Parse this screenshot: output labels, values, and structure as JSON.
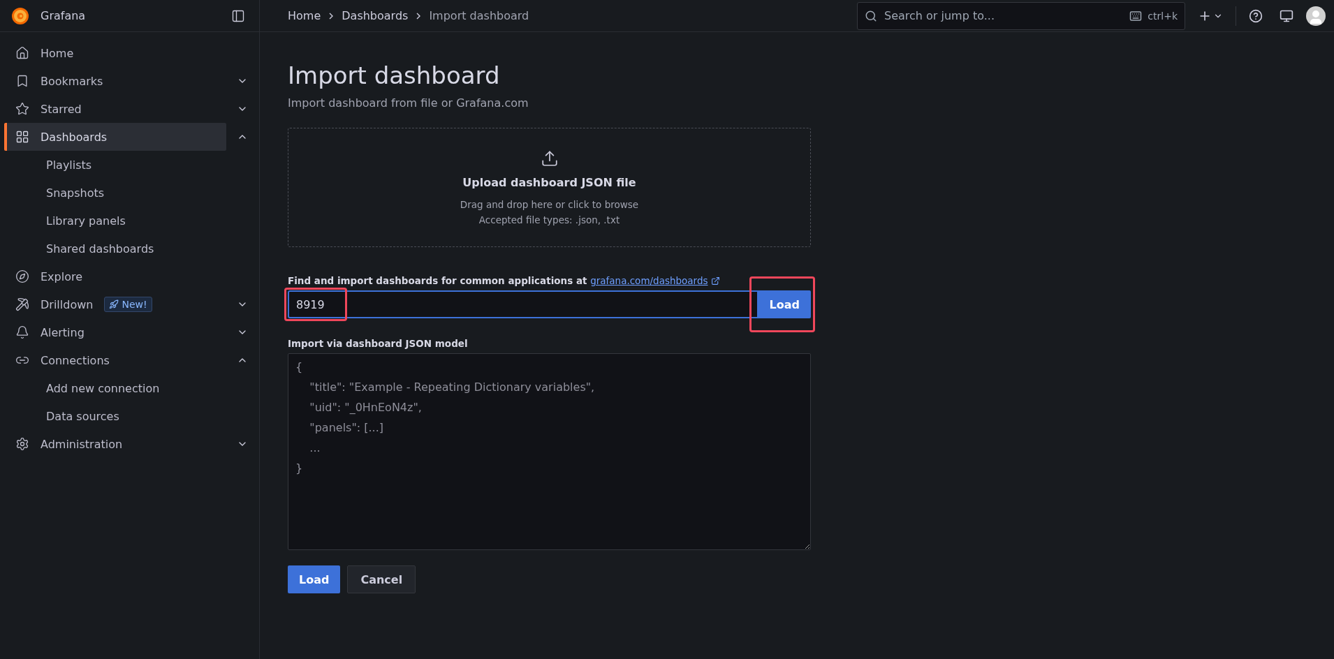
{
  "brand": {
    "name": "Grafana"
  },
  "sidebar": {
    "items": [
      {
        "label": "Home",
        "selected": false
      },
      {
        "label": "Bookmarks",
        "selected": false,
        "expanded": false
      },
      {
        "label": "Starred",
        "selected": false,
        "expanded": false
      },
      {
        "label": "Dashboards",
        "selected": true,
        "expanded": true,
        "children": [
          {
            "label": "Playlists",
            "selected": false
          },
          {
            "label": "Snapshots",
            "selected": false
          },
          {
            "label": "Library panels",
            "selected": false
          },
          {
            "label": "Shared dashboards",
            "selected": false
          }
        ]
      },
      {
        "label": "Explore",
        "selected": false
      },
      {
        "label": "Drilldown",
        "selected": false,
        "expanded": false,
        "badge": "New!"
      },
      {
        "label": "Alerting",
        "selected": false,
        "expanded": false
      },
      {
        "label": "Connections",
        "selected": false,
        "expanded": true,
        "children": [
          {
            "label": "Add new connection",
            "selected": false
          },
          {
            "label": "Data sources",
            "selected": false
          }
        ]
      },
      {
        "label": "Administration",
        "selected": false,
        "expanded": false
      }
    ]
  },
  "breadcrumbs": [
    "Home",
    "Dashboards",
    "Import dashboard"
  ],
  "search": {
    "placeholder": "Search or jump to...",
    "shortcut": "ctrl+k"
  },
  "page": {
    "title": "Import dashboard",
    "subtitle": "Import dashboard from file or Grafana.com",
    "upload": {
      "title": "Upload dashboard JSON file",
      "hint": "Drag and drop here or click to browse",
      "types": "Accepted file types: .json, .txt"
    },
    "grafana_com": {
      "label": "Find and import dashboards for common applications at",
      "link": "grafana.com/dashboards",
      "value": "8919",
      "button": "Load",
      "field_highlighted": true,
      "button_highlighted": true
    },
    "json_model": {
      "label": "Import via dashboard JSON model",
      "placeholder": "{\n    \"title\": \"Example - Repeating Dictionary variables\",\n    \"uid\": \"_0HnEoN4z\",\n    \"panels\": [...]\n    ...\n}"
    },
    "buttons": [
      {
        "label": "Load",
        "kind": "primary"
      },
      {
        "label": "Cancel",
        "kind": "secondary"
      }
    ]
  }
}
